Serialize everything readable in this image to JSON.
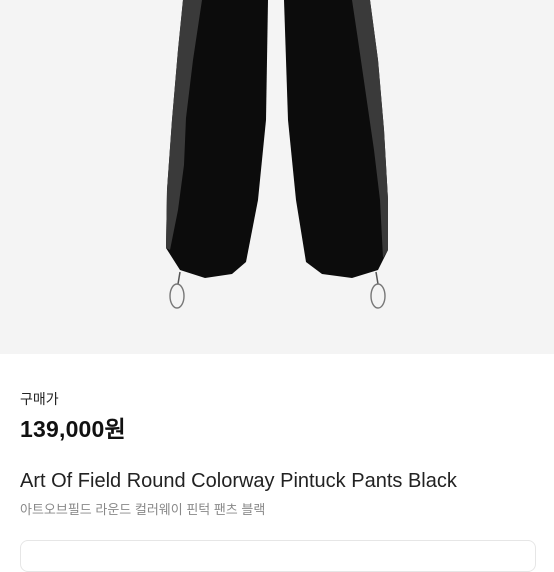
{
  "product": {
    "price_label": "구매가",
    "price": "139,000원",
    "name_en": "Art Of Field Round Colorway Pintuck Pants Black",
    "name_ko": "아트오브필드 라운드 컬러웨이 핀턱 팬츠 블랙"
  },
  "colors": {
    "image_bg": "#f4f4f4",
    "garment": "#0c0c0c",
    "panel": "#3a3a3a"
  }
}
